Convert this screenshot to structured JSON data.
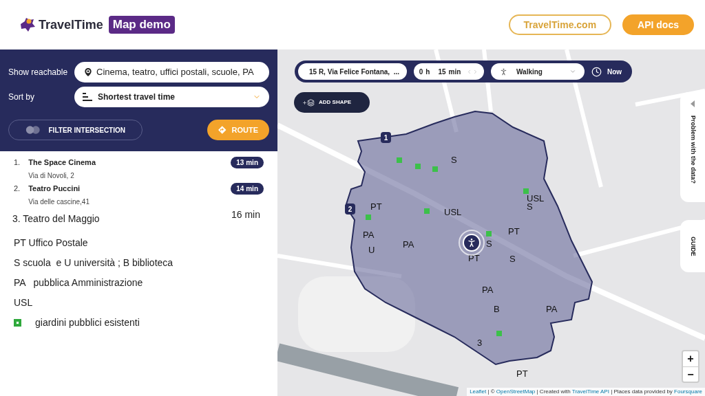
{
  "header": {
    "logo_text": "TravelTime",
    "badge": "Map demo",
    "links": [
      {
        "label": "TravelTime.com",
        "kind": "outline"
      },
      {
        "label": "API docs",
        "kind": "filled"
      }
    ]
  },
  "search": {
    "reachable_label": "Show reachable",
    "reachable_value": "Cinema, teatro, uffici postali, scuole, PA",
    "sort_label": "Sort by",
    "sort_value": "Shortest travel time",
    "filter_button": "FILTER INTERSECTION",
    "route_button": "ROUTE"
  },
  "results": [
    {
      "number": "1.",
      "name": "The Space Cinema",
      "address": "Via di Novoli, 2",
      "time": "13 min"
    },
    {
      "number": "2.",
      "name": "Teatro Puccini",
      "address": "Via delle cascine,41",
      "time": "14 min"
    }
  ],
  "notes": {
    "item": "3. Teatro del Maggio",
    "item_time": "16 min",
    "legend": [
      "PT Uffico Postale",
      "S scuola  e U università ; B biblioteca",
      "PA   pubblica Amministrazione",
      "USL"
    ],
    "garden_legend": "giardini pubblici esistenti"
  },
  "map": {
    "toolbar": {
      "origin": "15 R, Via Felice Fontana,  ...",
      "hours": "0",
      "hours_unit": "h",
      "minutes": "15",
      "minutes_unit": "min",
      "mode": "Walking",
      "departure": "Now"
    },
    "add_shape": "ADD SHAPE",
    "side_tabs": [
      "Problem with the data?",
      "GUIDE"
    ],
    "markers": [
      "1",
      "2"
    ],
    "annotations": [
      "S",
      "USL",
      "S",
      "PT",
      "USL",
      "PT",
      "PA",
      "PA",
      "U",
      "S",
      "PT",
      "S",
      "PA",
      "B",
      "PA",
      "3",
      "PT"
    ],
    "zoom": [
      "+",
      "−"
    ],
    "attribution": [
      {
        "text": "Leaflet",
        "kind": "link"
      },
      {
        "text": " | © ",
        "kind": "text"
      },
      {
        "text": "OpenStreetMap",
        "kind": "link"
      },
      {
        "text": " | Created with ",
        "kind": "text"
      },
      {
        "text": "TravelTime API",
        "kind": "link"
      },
      {
        "text": " | Places data provided by ",
        "kind": "text"
      },
      {
        "text": "Foursquare",
        "kind": "link"
      }
    ]
  }
}
